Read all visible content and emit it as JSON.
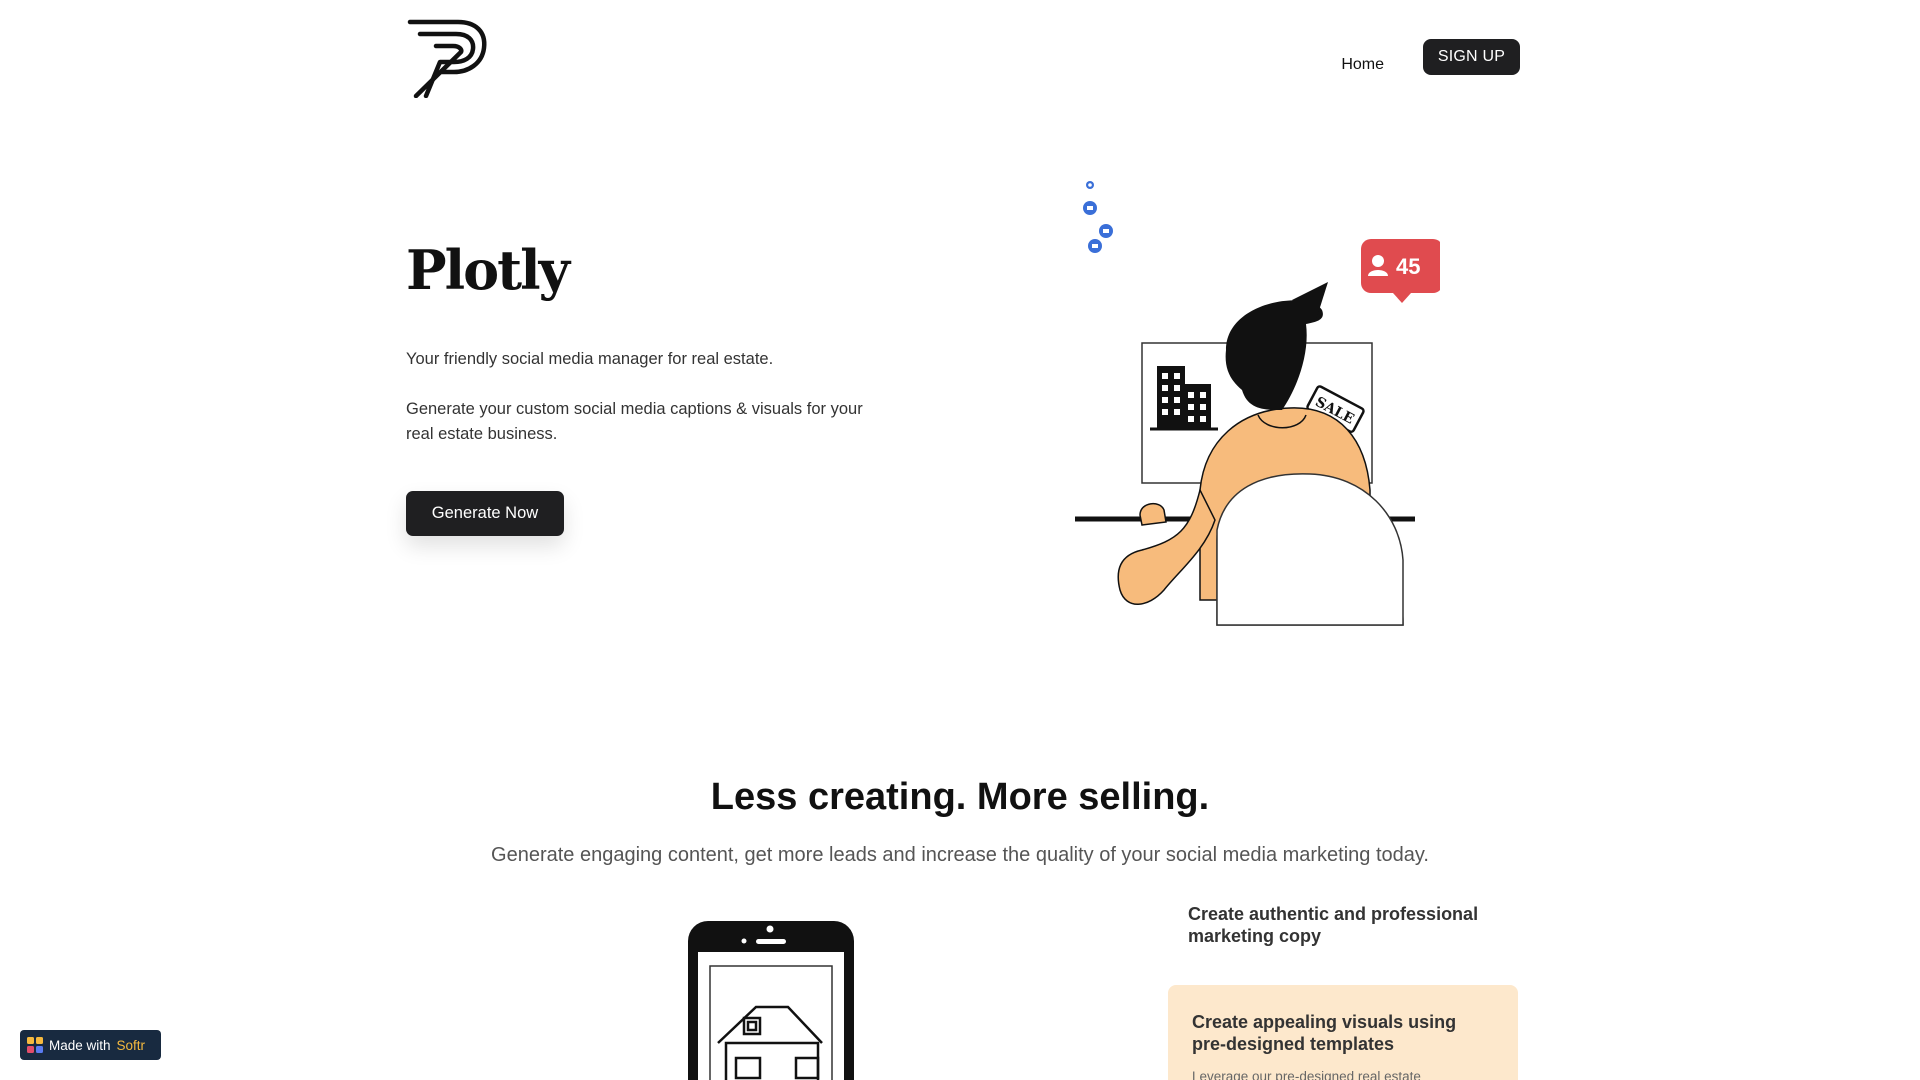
{
  "header": {
    "logo_alt": "P",
    "nav_home": "Home",
    "signup_label": "SIGN UP"
  },
  "hero": {
    "title": "Plotly",
    "tagline": "Your friendly social media manager for real estate.",
    "description": "Generate your custom social media captions & visuals for your real estate business.",
    "cta_label": "Generate Now",
    "notification_count": "45",
    "sale_tag": "SALE"
  },
  "section": {
    "title": "Less creating. More selling.",
    "subtitle": "Generate engaging content, get more leads and increase the quality of your social media marketing today."
  },
  "features": {
    "item1_title": "Create authentic and professional marketing copy",
    "item2_title": "Create appealing visuals using pre-designed templates",
    "item2_desc": "Leverage our pre-designed real estate"
  },
  "badge": {
    "prefix": "Made with",
    "brand": "Softr"
  },
  "colors": {
    "primary_button": "#1f1f21",
    "notification_red": "#e04b4f",
    "feature_card_bg": "#fde8cc",
    "skin_orange": "#f7bb7c",
    "like_blue": "#3a6fd8"
  }
}
